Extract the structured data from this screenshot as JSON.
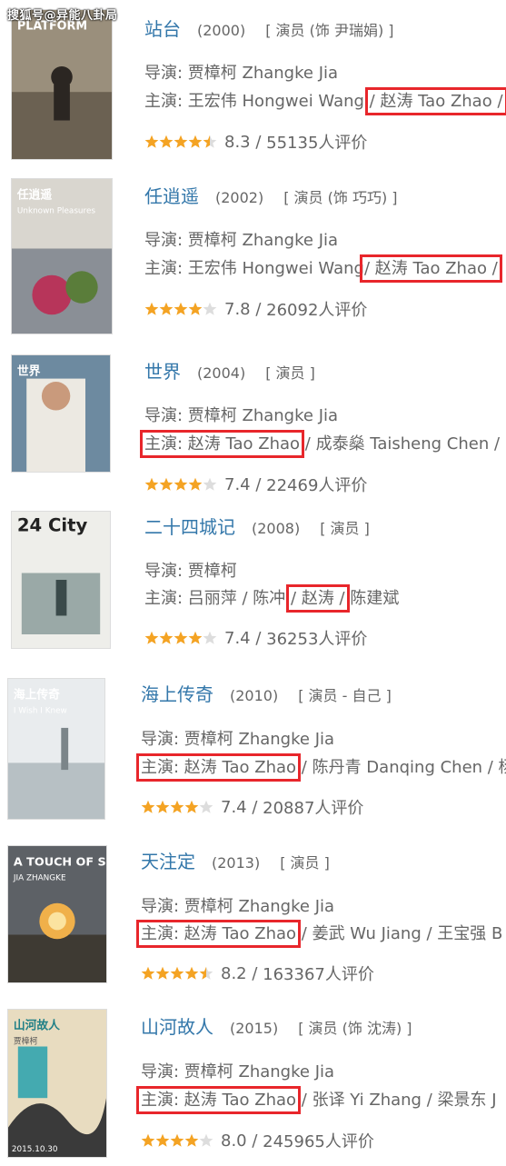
{
  "watermark": "搜狐号@异能八卦局",
  "films": [
    {
      "title": "站台",
      "year": "(2000)",
      "role": "[ 演员 (饰 尹瑞娟) ]",
      "director": "导演: 贾樟柯 Zhangke Jia",
      "cast_prefix": "主演: ",
      "cast_before": "王宏伟 Hongwei Wang ",
      "cast_highlight": "/ 赵涛 Tao Zhao /",
      "cast_after": "",
      "rating": "8.3",
      "votes": "55135人评价",
      "stars": 4.5,
      "poster_text": "PLATFORM",
      "poster_bg": "#9a8f7c"
    },
    {
      "title": "任逍遥",
      "year": "(2002)",
      "role": "[ 演员 (饰 巧巧) ]",
      "director": "导演: 贾樟柯 Zhangke Jia",
      "cast_prefix": "主演: ",
      "cast_before": "王宏伟 Hongwei Wang",
      "cast_highlight": "/ 赵涛 Tao Zhao /",
      "cast_after": "",
      "rating": "7.8",
      "votes": "26092人评价",
      "stars": 4,
      "poster_text": "任逍遥",
      "poster_sub": "Unknown Pleasures",
      "poster_bg": "#d9d6cf"
    },
    {
      "title": "世界",
      "year": "(2004)",
      "role": "[ 演员 ]",
      "director": "导演: 贾樟柯 Zhangke Jia",
      "cast_prefix": "",
      "cast_before": "",
      "cast_highlight": "主演: 赵涛 Tao Zhao",
      "cast_after": " / 成泰燊 Taisheng Chen /",
      "rating": "7.4",
      "votes": "22469人评价",
      "stars": 4,
      "poster_text": "世界",
      "poster_bg": "#6d8aa0"
    },
    {
      "title": "二十四城记",
      "year": "(2008)",
      "role": "[ 演员 ]",
      "director": "导演: 贾樟柯",
      "cast_prefix": "主演: ",
      "cast_before": "吕丽萍 / 陈冲 ",
      "cast_highlight": "/ 赵涛 /",
      "cast_after": " 陈建斌",
      "rating": "7.4",
      "votes": "36253人评价",
      "stars": 4,
      "poster_text": "24 City",
      "poster_bg": "#eeeeea"
    },
    {
      "title": "海上传奇",
      "year": "(2010)",
      "role": "[ 演员 - 自己 ]",
      "director": "导演: 贾樟柯 Zhangke Jia",
      "cast_prefix": "",
      "cast_before": "",
      "cast_highlight": "主演: 赵涛 Tao Zhao",
      "cast_after": " / 陈丹青 Danqing Chen / 杨",
      "rating": "7.4",
      "votes": "20887人评价",
      "stars": 4,
      "poster_text": "海上传奇",
      "poster_sub": "I Wish I Knew",
      "poster_bg": "#e9ecee"
    },
    {
      "title": "天注定",
      "year": "(2013)",
      "role": "[ 演员 ]",
      "director": "导演: 贾樟柯 Zhangke Jia",
      "cast_prefix": "",
      "cast_before": "",
      "cast_highlight": "主演: 赵涛 Tao Zhao",
      "cast_after": " / 姜武 Wu Jiang / 王宝强 B",
      "rating": "8.2",
      "votes": "163367人评价",
      "stars": 4.5,
      "poster_text": "A TOUCH OF SIN",
      "poster_sub": "JIA ZHANGKE",
      "poster_bg": "#5d6166"
    },
    {
      "title": "山河故人",
      "year": "(2015)",
      "role": "[ 演员 (饰 沈涛) ]",
      "director": "导演: 贾樟柯 Zhangke Jia",
      "cast_prefix": "",
      "cast_before": "",
      "cast_highlight": "主演: 赵涛 Tao Zhao",
      "cast_after": " / 张译 Yi Zhang / 梁景东 J",
      "rating": "8.0",
      "votes": "245965人评价",
      "stars": 4,
      "poster_text": "山河故人",
      "poster_sub": "贾樟柯",
      "poster_date": "2015.10.30",
      "poster_bg": "#e8dcc0"
    }
  ],
  "colors": {
    "title_link": "#3377aa",
    "text": "#666666",
    "highlight_box": "#e8262b",
    "star_full": "#f4a323",
    "star_empty": "#dddddd"
  }
}
